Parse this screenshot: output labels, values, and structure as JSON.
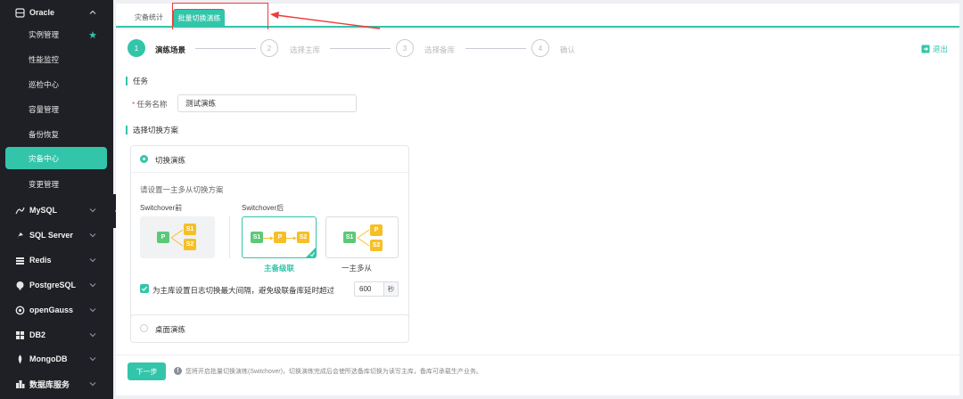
{
  "sidebar": {
    "oracle": {
      "label": "Oracle"
    },
    "oracle_items": [
      {
        "label": "实例管理"
      },
      {
        "label": "性能监控"
      },
      {
        "label": "巡检中心"
      },
      {
        "label": "容量管理"
      },
      {
        "label": "备份恢复"
      },
      {
        "label": "灾备中心"
      },
      {
        "label": "变更管理"
      }
    ],
    "databases": [
      {
        "label": "MySQL",
        "icon": "mysql-icon"
      },
      {
        "label": "SQL Server",
        "icon": "sql-server-icon"
      },
      {
        "label": "Redis",
        "icon": "redis-icon"
      },
      {
        "label": "PostgreSQL",
        "icon": "postgresql-icon"
      },
      {
        "label": "openGauss",
        "icon": "opengauss-icon"
      },
      {
        "label": "DB2",
        "icon": "db2-icon"
      },
      {
        "label": "MongoDB",
        "icon": "mongodb-icon"
      },
      {
        "label": "数据库服务",
        "icon": "db-service-icon"
      }
    ]
  },
  "tabs": [
    {
      "label": "灾备统计"
    },
    {
      "label": "批量切换演练"
    }
  ],
  "steps": [
    {
      "num": "1",
      "label": "演练场景"
    },
    {
      "num": "2",
      "label": "选择主库"
    },
    {
      "num": "3",
      "label": "选择备库"
    },
    {
      "num": "4",
      "label": "确认"
    }
  ],
  "exit_label": "退出",
  "task": {
    "section": "任务",
    "name_label": "任务名称",
    "name_value": "测试演练"
  },
  "plan": {
    "section": "选择切换方案",
    "option_switch": "切换演练",
    "hint": "请设置一主多从切换方案",
    "before_label": "Switchover前",
    "after_label": "Switchover后",
    "caption_cascade": "主备级联",
    "caption_one_many": "一主多从",
    "nodes": {
      "p": "P",
      "s1": "S1",
      "s2": "S2"
    },
    "checkbox_label": "为主库设置日志切换最大间隔，避免级联备库延时超过",
    "interval_value": "600",
    "interval_unit": "秒",
    "option_desktop": "桌面演练"
  },
  "footer": {
    "next_label": "下一步",
    "info_text": "您将开启批量切换演练(Switchover)，切换演练完成后会使所选备库切换为读写主库，备库可承载生产业务。"
  },
  "colors": {
    "accent": "#33c5aa",
    "sidebar_bg": "#1e2025",
    "primary_node": "#5cc978",
    "standby_node": "#f6bf26",
    "annotation": "#ee3b3b"
  }
}
